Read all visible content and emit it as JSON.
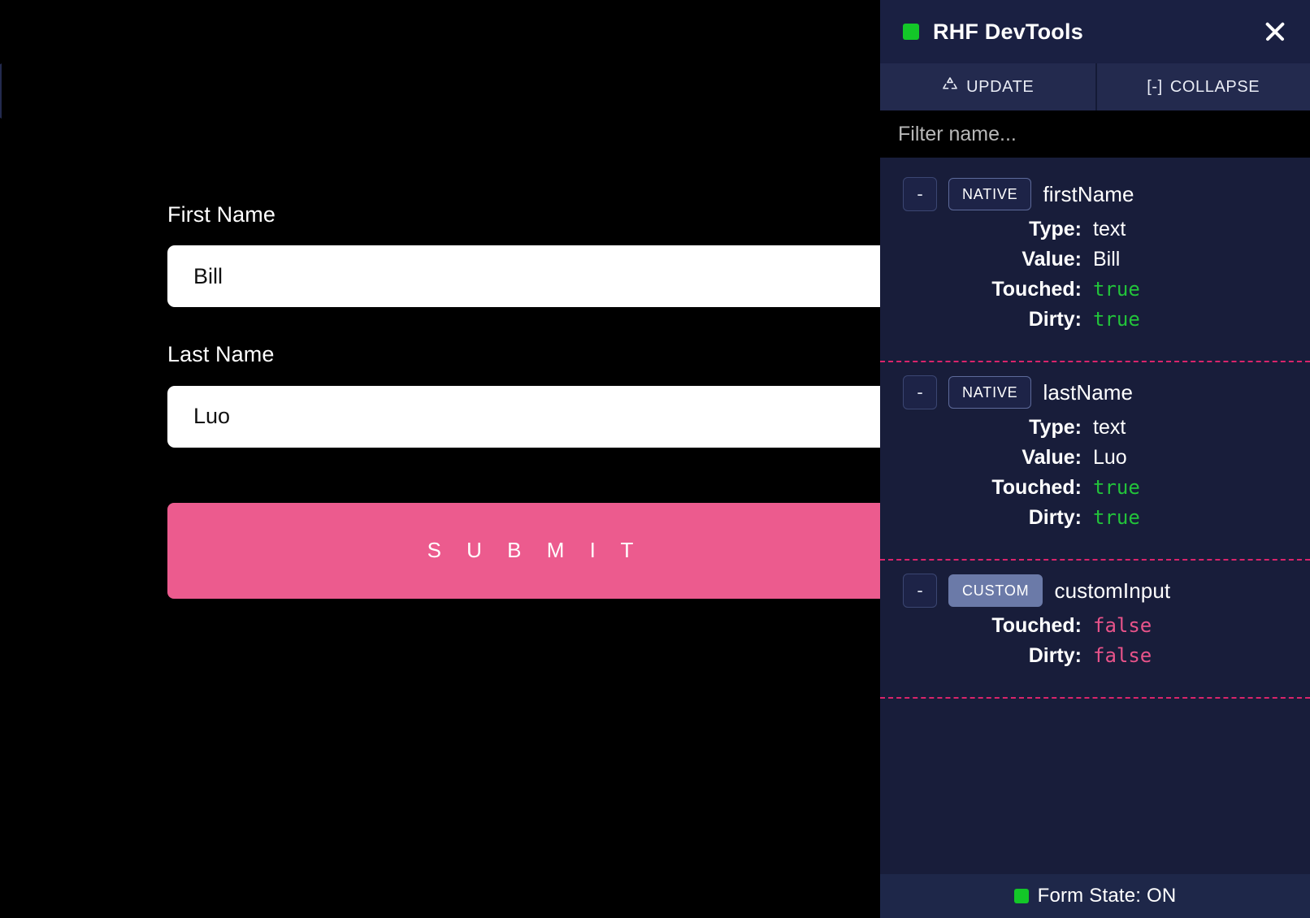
{
  "form": {
    "fields": [
      {
        "label": "First Name",
        "value": "Bill",
        "placeholder": ""
      },
      {
        "label": "Last Name",
        "value": "Luo",
        "placeholder": ""
      }
    ],
    "submit_label": "S U B M I T"
  },
  "devtools": {
    "title": "RHF DevTools",
    "status_dot_color": "#13c728",
    "close_icon": "close-icon",
    "tabs": [
      {
        "label": "UPDATE",
        "icon": "recycle-icon"
      },
      {
        "label": "COLLAPSE",
        "icon": "bracket-minus-icon"
      }
    ],
    "collapse_prefix": "[-]",
    "filter": {
      "value": "",
      "placeholder": "Filter name..."
    },
    "fields": [
      {
        "collapse_label": "-",
        "badge": "NATIVE",
        "badge_kind": "native",
        "name": "firstName",
        "rows": [
          {
            "key": "Type:",
            "value": "text",
            "kind": "plain"
          },
          {
            "key": "Value:",
            "value": "Bill",
            "kind": "plain"
          },
          {
            "key": "Touched:",
            "value": "true",
            "kind": "true"
          },
          {
            "key": "Dirty:",
            "value": "true",
            "kind": "true"
          }
        ]
      },
      {
        "collapse_label": "-",
        "badge": "NATIVE",
        "badge_kind": "native",
        "name": "lastName",
        "rows": [
          {
            "key": "Type:",
            "value": "text",
            "kind": "plain"
          },
          {
            "key": "Value:",
            "value": "Luo",
            "kind": "plain"
          },
          {
            "key": "Touched:",
            "value": "true",
            "kind": "true"
          },
          {
            "key": "Dirty:",
            "value": "true",
            "kind": "true"
          }
        ]
      },
      {
        "collapse_label": "-",
        "badge": "CUSTOM",
        "badge_kind": "custom",
        "name": "customInput",
        "rows": [
          {
            "key": "Touched:",
            "value": "false",
            "kind": "false"
          },
          {
            "key": "Dirty:",
            "value": "false",
            "kind": "false"
          }
        ]
      }
    ],
    "footer": {
      "label": "Form State: ON",
      "dot_color": "#13c728"
    }
  },
  "colors": {
    "accent_pink": "#ec5b8e",
    "panel_bg": "#181d3a",
    "panel_header_bg": "#1a2042",
    "tab_bg": "#232a4e",
    "divider_pink": "#d9246b",
    "true_green": "#22c33a",
    "false_pink": "#e8538a",
    "page_bg": "#000000"
  }
}
